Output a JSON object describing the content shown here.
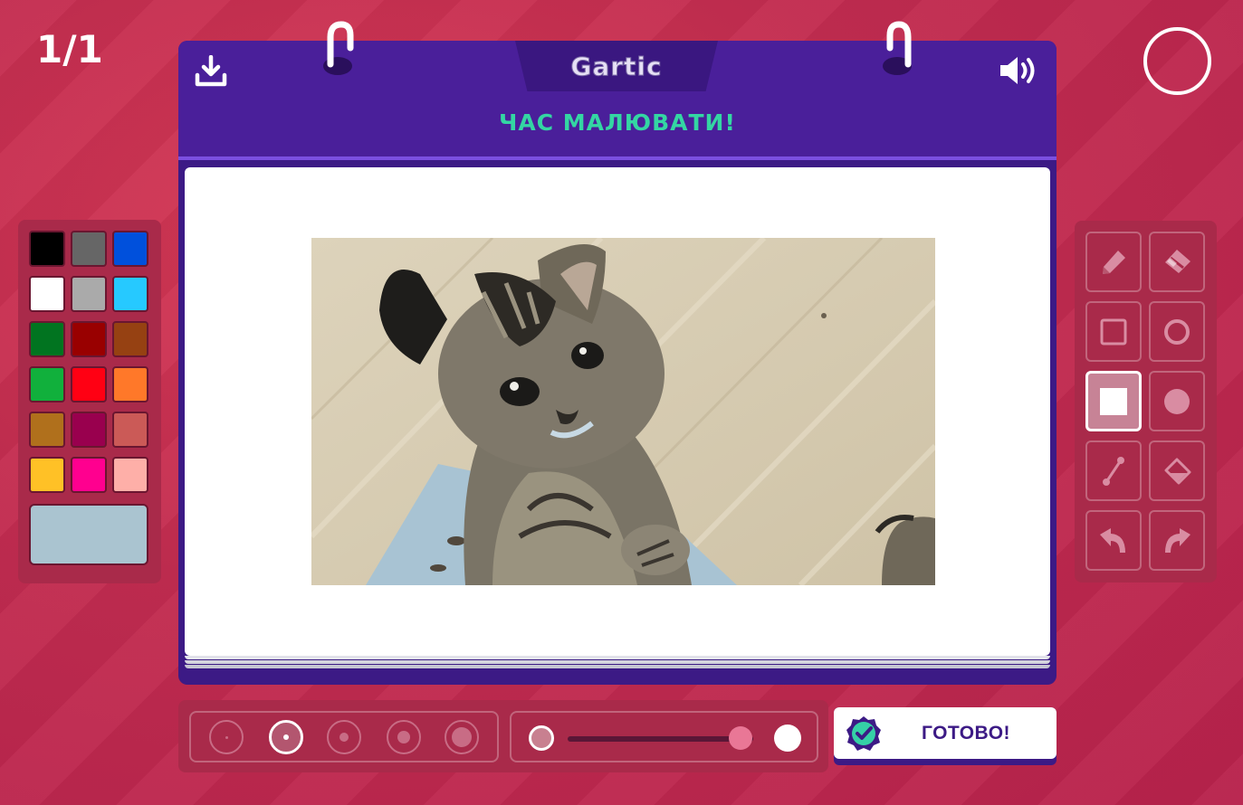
{
  "round": {
    "counter": "1/1"
  },
  "header": {
    "logo": "Gartic",
    "title": "ЧАС МАЛЮВАТИ!"
  },
  "icons": {
    "download": "download-icon",
    "sound": "speaker-icon",
    "timer": "timer-circle-icon"
  },
  "palette": {
    "colors": [
      "#000000",
      "#666666",
      "#0050dc",
      "#ffffff",
      "#aaaaaa",
      "#26c9ff",
      "#017420",
      "#990000",
      "#964112",
      "#11b03c",
      "#ff0013",
      "#ff7829",
      "#b0701c",
      "#99004e",
      "#cb5a57",
      "#ffc126",
      "#ff008f",
      "#feafa8"
    ],
    "current": "#aac4d0"
  },
  "tools": [
    {
      "name": "pencil",
      "icon": "pencil-icon",
      "active": false
    },
    {
      "name": "eraser",
      "icon": "eraser-icon",
      "active": false
    },
    {
      "name": "rectangle-outline",
      "icon": "square-outline-icon",
      "active": false
    },
    {
      "name": "ellipse-outline",
      "icon": "circle-outline-icon",
      "active": false
    },
    {
      "name": "rectangle-filled",
      "icon": "square-filled-icon",
      "active": true
    },
    {
      "name": "ellipse-filled",
      "icon": "circle-filled-icon",
      "active": false
    },
    {
      "name": "line",
      "icon": "line-icon",
      "active": false
    },
    {
      "name": "fill",
      "icon": "bucket-icon",
      "active": false
    },
    {
      "name": "undo",
      "icon": "undo-icon",
      "active": false
    },
    {
      "name": "redo",
      "icon": "redo-icon",
      "active": false
    }
  ],
  "brush_sizes": {
    "count": 5,
    "selected_index": 1
  },
  "opacity": {
    "value": 0.9
  },
  "done_button": {
    "label": "ГОТОВО!",
    "icon": "check-badge-icon"
  }
}
